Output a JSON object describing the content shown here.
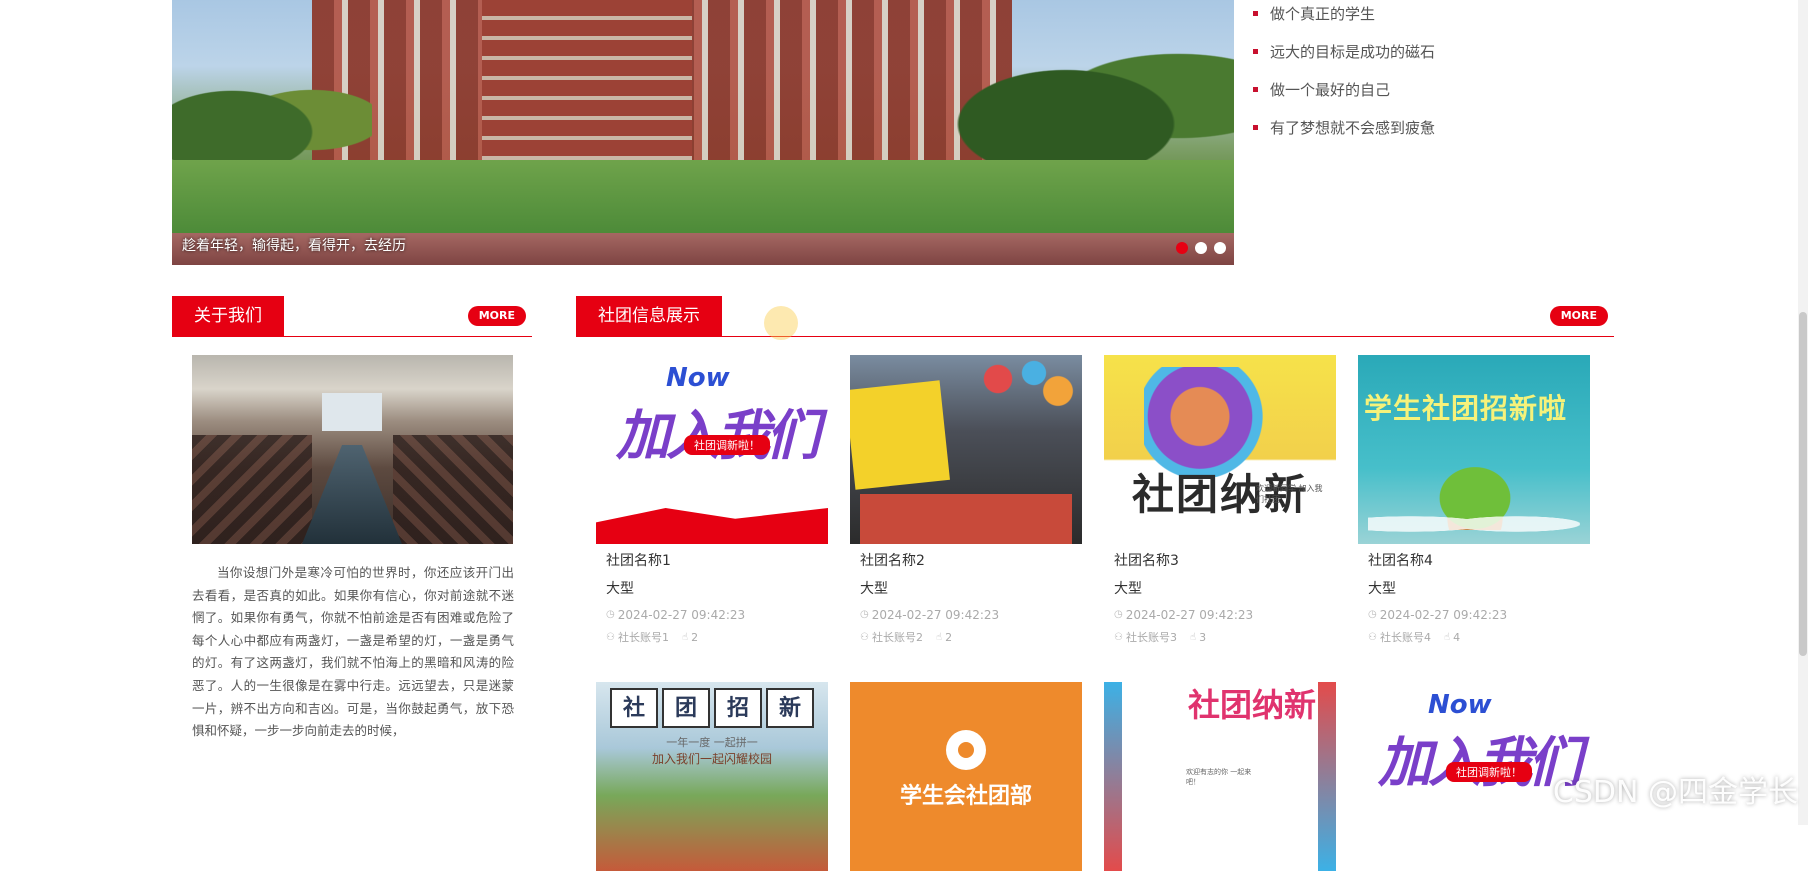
{
  "banner": {
    "caption": "趁着年轻，输得起，看得开，去经历",
    "active_slide": 1,
    "slide_count": 3
  },
  "notices": [
    "做个真正的学生",
    "远大的目标是成功的磁石",
    "做一个最好的自己",
    "有了梦想就不会感到疲惫"
  ],
  "about": {
    "title": "关于我们",
    "more_label": "MORE",
    "text": "当你设想门外是寒冷可怕的世界时，你还应该开门出去看看，是否真的如此。如果你有信心，你对前途就不迷惘了。如果你有勇气，你就不怕前途是否有困难或危险了每个人心中都应有两盏灯，一盏是希望的灯，一盏是勇气的灯。有了这两盏灯，我们就不怕海上的黑暗和风涛的险恶了。人的一生很像是在雾中行走。远远望去，只是迷蒙一片，辨不出方向和吉凶。可是，当你鼓起勇气，放下恐惧和怀疑，一步一步向前走去的时候，"
  },
  "clubs": {
    "title": "社团信息展示",
    "more_label": "MORE",
    "items": [
      {
        "name": "社团名称1",
        "type": "大型",
        "time": "2024-02-27 09:42:23",
        "account": "社长账号1",
        "count": "2"
      },
      {
        "name": "社团名称2",
        "type": "大型",
        "time": "2024-02-27 09:42:23",
        "account": "社长账号2",
        "count": "2"
      },
      {
        "name": "社团名称3",
        "type": "大型",
        "time": "2024-02-27 09:42:23",
        "account": "社长账号3",
        "count": "3"
      },
      {
        "name": "社团名称4",
        "type": "大型",
        "time": "2024-02-27 09:42:23",
        "account": "社长账号4",
        "count": "4"
      }
    ],
    "images": {
      "join_now": "Now",
      "join_big": "加入我们",
      "join_ribbon": "社团调新啦！",
      "recruit_big": "社团纳新",
      "recruit_small": "欢迎新同学 加入我们社团",
      "student_title": "学生社团招新啦",
      "shetuan_chars": [
        "社",
        "团",
        "招",
        "新"
      ],
      "shetuan_sub": "一年一度 一起拼一",
      "shetuan_sub2": "加入我们一起闪耀校园",
      "orange_text": "学生会社团部",
      "new_title": "社团纳新",
      "new_small": "欢迎有志的你 一起来吧！"
    }
  },
  "watermark": "CSDN @四金学长"
}
